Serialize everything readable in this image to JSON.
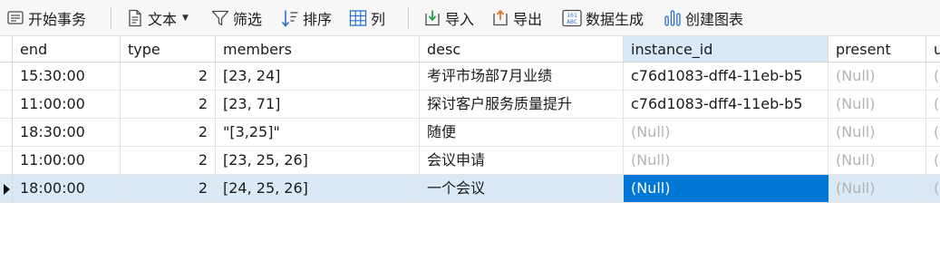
{
  "toolbar": {
    "begin_transaction": "开始事务",
    "text": "文本",
    "filter": "筛选",
    "sort": "排序",
    "columns": "列",
    "import": "导入",
    "export": "导出",
    "generate_data": "数据生成",
    "create_chart": "创建图表"
  },
  "grid": {
    "headers": [
      "end",
      "type",
      "members",
      "desc",
      "instance_id",
      "present",
      "u"
    ],
    "selected_column": "instance_id",
    "rows": [
      {
        "end": "15:30:00",
        "type": "2",
        "members": "[23, 24]",
        "desc": "考评市场部7月业绩",
        "instance_id": "c76d1083-dff4-11eb-b5",
        "present": "(Null)",
        "u": "("
      },
      {
        "end": "11:00:00",
        "type": "2",
        "members": "[23, 71]",
        "desc": "探讨客户服务质量提升",
        "instance_id": "c76d1083-dff4-11eb-b5",
        "present": "(Null)",
        "u": "("
      },
      {
        "end": "18:30:00",
        "type": "2",
        "members": "\"[3,25]\"",
        "desc": "随便",
        "instance_id": "(Null)",
        "present": "(Null)",
        "u": "("
      },
      {
        "end": "11:00:00",
        "type": "2",
        "members": "[23, 25, 26]",
        "desc": "会议申请",
        "instance_id": "(Null)",
        "present": "(Null)",
        "u": "("
      },
      {
        "end": "18:00:00",
        "type": "2",
        "members": "[24, 25, 26]",
        "desc": "一个会议",
        "instance_id": "(Null)",
        "present": "(Null)",
        "u": "("
      }
    ],
    "current_row": 4
  },
  "colors": {
    "accent": "#0078d7",
    "selected_row": "#dbe9f6",
    "selected_header": "#d9e9f7",
    "null_text": "#b4b4b4"
  }
}
